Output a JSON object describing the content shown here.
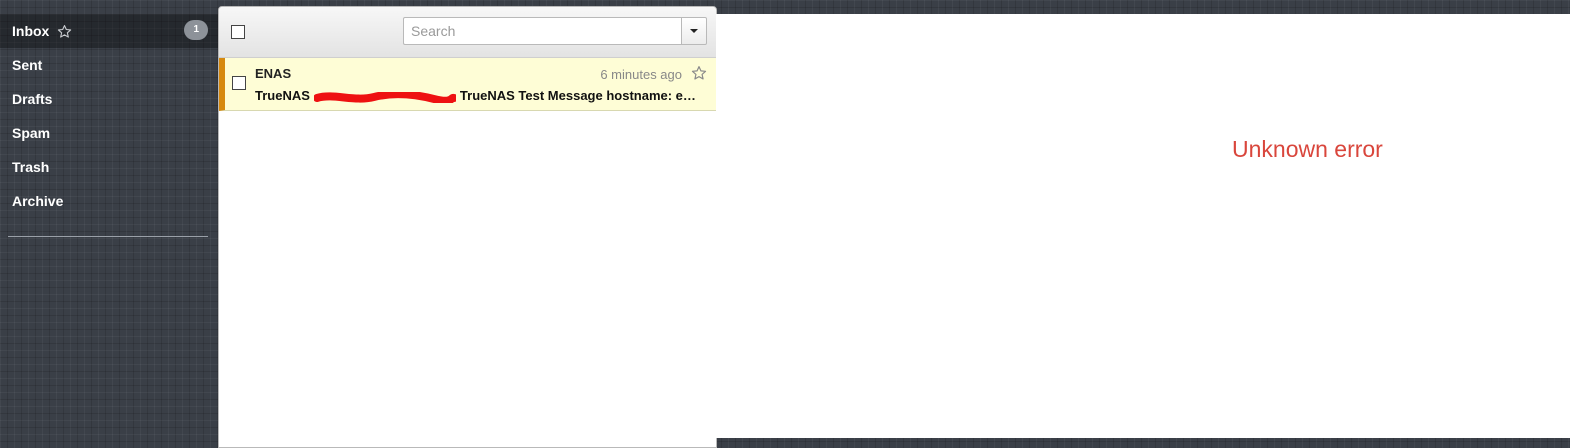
{
  "sidebar": {
    "folders": [
      {
        "label": "Inbox",
        "badge": "1"
      },
      {
        "label": "Sent"
      },
      {
        "label": "Drafts"
      },
      {
        "label": "Spam"
      },
      {
        "label": "Trash"
      },
      {
        "label": "Archive"
      }
    ]
  },
  "toolbar": {
    "search_placeholder": "Search"
  },
  "messages": [
    {
      "sender": "ENAS",
      "time": "6 minutes ago",
      "subject_prefix": "TrueNAS",
      "subject_rest": "TrueNAS Test Message hostname: enas.local",
      "highlight_color": "#fefdd6",
      "accent_color": "#d6890f"
    }
  ],
  "reading_pane": {
    "error": "Unknown error",
    "error_color": "#d9463c"
  },
  "icons": {
    "star": "star-outline-icon",
    "dropdown": "caret-down-icon"
  }
}
